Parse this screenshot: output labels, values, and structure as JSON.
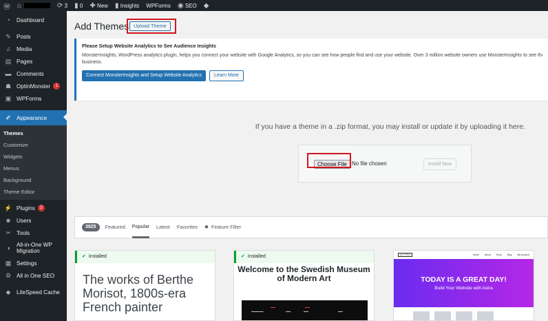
{
  "admin_bar": {
    "comments_count": "0",
    "updates_count": "3",
    "new_label": "New",
    "insights_label": "Insights",
    "wpforms_label": "WPForms",
    "seo_label": "SEO"
  },
  "sidebar": {
    "items": [
      {
        "label": "Dashboard",
        "icon": "dashboard-icon"
      },
      {
        "label": "Posts",
        "icon": "pin-icon"
      },
      {
        "label": "Media",
        "icon": "media-icon"
      },
      {
        "label": "Pages",
        "icon": "pages-icon"
      },
      {
        "label": "Comments",
        "icon": "comments-icon"
      },
      {
        "label": "OptinMonster",
        "icon": "optinmonster-icon",
        "badge": "1"
      },
      {
        "label": "WPForms",
        "icon": "wpforms-icon"
      },
      {
        "label": "Appearance",
        "icon": "brush-icon"
      }
    ],
    "submenu": [
      "Themes",
      "Customize",
      "Widgets",
      "Menus",
      "Background",
      "Theme Editor"
    ],
    "items2": [
      {
        "label": "Plugins",
        "icon": "plugins-icon",
        "badge": "2"
      },
      {
        "label": "Users",
        "icon": "users-icon"
      },
      {
        "label": "Tools",
        "icon": "tools-icon"
      },
      {
        "label": "All-in-One WP Migration",
        "icon": "migration-icon"
      },
      {
        "label": "Settings",
        "icon": "settings-icon"
      },
      {
        "label": "All in One SEO",
        "icon": "seo-icon"
      },
      {
        "label": "LiteSpeed Cache",
        "icon": "litespeed-icon"
      }
    ]
  },
  "page": {
    "title": "Add Themes",
    "upload_button": "Upload Theme"
  },
  "notice": {
    "title": "Please Setup Website Analytics to See Audience Insights",
    "text_line1": "MonsterInsights, WordPress analytics plugin, helps you connect your website with Google Analytics, so you can see how people find and use your website. Over 3 million website owners use MonsterInsights to see the stats that matter and grow their",
    "text_line2": "business.",
    "primary_button": "Connect MonsterInsights and Setup Website Analytics",
    "secondary_button": "Learn More"
  },
  "upload": {
    "instructions": "If you have a theme in a .zip format, you may install or update it by uploading it here.",
    "choose_file": "Choose File",
    "no_file": "No file chosen",
    "install_now": "Install Now"
  },
  "filter": {
    "count": "3925",
    "tabs": [
      "Featured",
      "Popular",
      "Latest",
      "Favorites"
    ],
    "active_tab": "Popular",
    "feature_filter": "Feature Filter"
  },
  "themes": [
    {
      "installed": "Installed",
      "preview_text": "The works of Berthe Morisot, 1800s-era French painter"
    },
    {
      "installed": "Installed",
      "preview_title": "Welcome to the Swedish Museum of Modern Art"
    },
    {
      "logo": "ASTRA",
      "nav": [
        "Home",
        "About",
        "Shop",
        "Blog",
        "My Account"
      ],
      "hero_title": "TODAY IS A GREAT DAY!",
      "hero_subtitle": "Build Your Website with Astra"
    }
  ],
  "colors": {
    "admin_dark": "#1d2327",
    "accent": "#2271b1",
    "highlight": "#d0151d",
    "badge": "#d63638"
  }
}
